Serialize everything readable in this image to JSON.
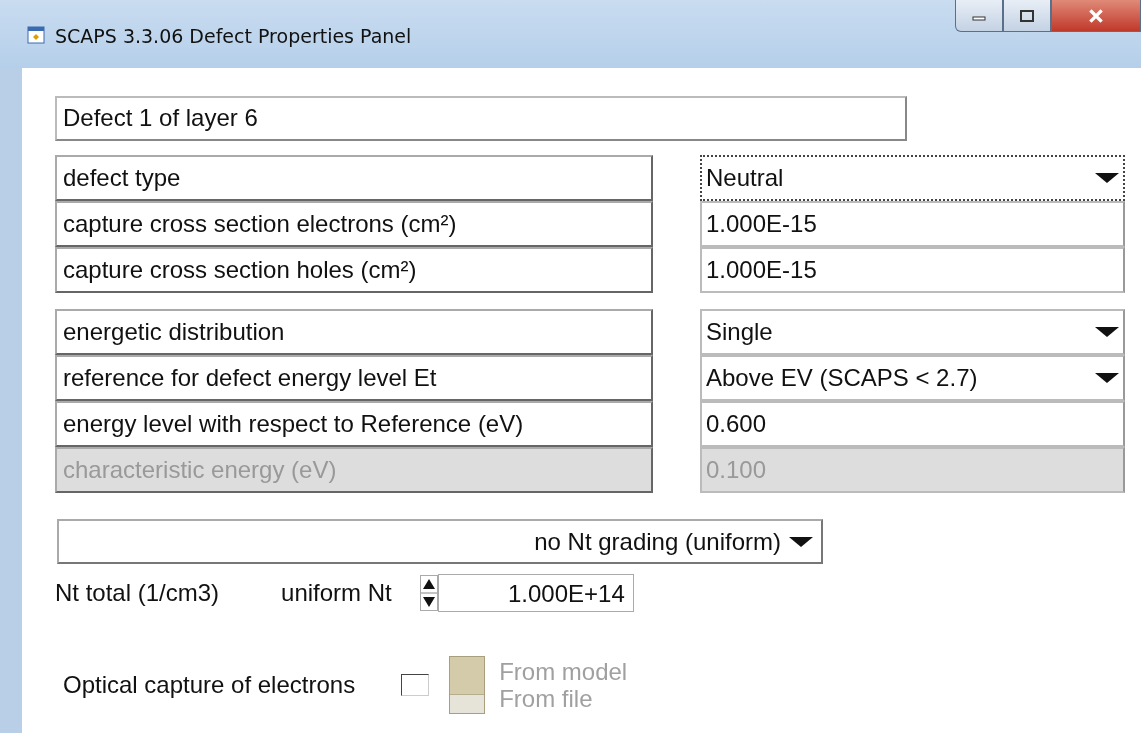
{
  "window": {
    "title": "SCAPS 3.3.06 Defect Properties Panel"
  },
  "defect_header": "Defect 1 of layer 6",
  "groups": [
    {
      "rows": [
        {
          "label": "defect type",
          "kind": "select",
          "value": "Neutral",
          "disabled": false,
          "focused": true
        },
        {
          "label": "capture cross section electrons (cm²)",
          "kind": "input",
          "value": "1.000E-15",
          "disabled": false
        },
        {
          "label": "capture cross section holes (cm²)",
          "kind": "input",
          "value": "1.000E-15",
          "disabled": false
        }
      ]
    },
    {
      "rows": [
        {
          "label": "energetic distribution",
          "kind": "select",
          "value": "Single",
          "disabled": false,
          "focused": false
        },
        {
          "label": "reference for defect energy level Et",
          "kind": "select",
          "value": "Above EV (SCAPS < 2.7)",
          "disabled": false,
          "focused": false
        },
        {
          "label": "energy level with respect to Reference (eV)",
          "kind": "input",
          "value": "0.600",
          "disabled": false
        },
        {
          "label": "characteristic energy (eV)",
          "kind": "input",
          "value": "0.100",
          "disabled": true
        }
      ]
    }
  ],
  "grading": {
    "value": "no Nt grading (uniform)"
  },
  "nt_total": {
    "label": "Nt total (1/cm3)",
    "mode_label": "uniform Nt",
    "value": "1.000E+14"
  },
  "optical": {
    "label": "Optical capture of electrons",
    "checked": false,
    "disabled": true,
    "options": [
      {
        "label": "From model",
        "selected": true
      },
      {
        "label": "From file",
        "selected": false
      }
    ]
  }
}
